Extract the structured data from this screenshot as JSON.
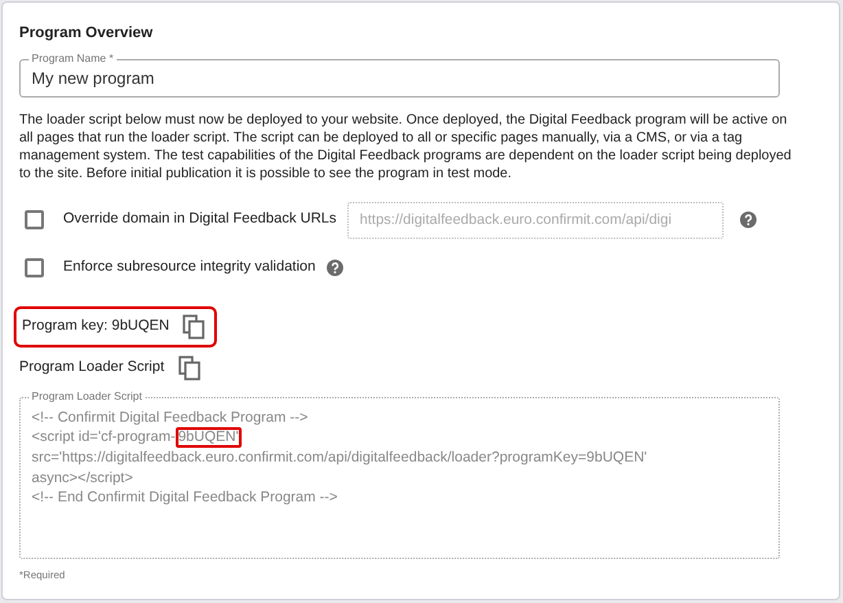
{
  "section_title": "Program Overview",
  "program_name": {
    "label": "Program Name *",
    "value": "My new program"
  },
  "description": "The loader script below must now be deployed to your website. Once deployed, the Digital Feedback program will be active on all pages that run the loader script. The script can be deployed to all or specific pages manually, via a CMS, or via a tag management system. The test capabilities of the Digital Feedback programs are dependent on the loader script being deployed to the site. Before initial publication it is possible to see the program in test mode.",
  "options": [
    {
      "kind": "field",
      "label": "Override domain in Digital Feedback URLs",
      "checked": false,
      "placeholder": "https://digitalfeedback.euro.confirmit.com/api/digi"
    },
    {
      "kind": "plain",
      "label": "Enforce subresource integrity validation",
      "checked": false
    }
  ],
  "program_key": {
    "label": "Program key: 9bUQEN",
    "highlighted": true
  },
  "loader_script_heading": "Program Loader Script",
  "loader_script": {
    "label": "Program Loader Script",
    "lines": [
      {
        "segments": [
          {
            "text": "<!-- Confirmit Digital Feedback Program -->",
            "highlighted": false
          }
        ]
      },
      {
        "segments": [
          {
            "text": "<script id='cf-program-",
            "highlighted": false
          },
          {
            "text": "9bUQEN'",
            "highlighted": true
          }
        ]
      },
      {
        "segments": [
          {
            "text": "src='https://digitalfeedback.euro.confirmit.com/api/digitalfeedback/loader?programKey=9bUQEN'",
            "highlighted": false
          }
        ]
      },
      {
        "segments": [
          {
            "text": "async></script>",
            "highlighted": false
          }
        ]
      },
      {
        "segments": [
          {
            "text": "<!-- End Confirmit Digital Feedback Program -->",
            "highlighted": false
          }
        ]
      }
    ]
  },
  "required_note": "*Required"
}
